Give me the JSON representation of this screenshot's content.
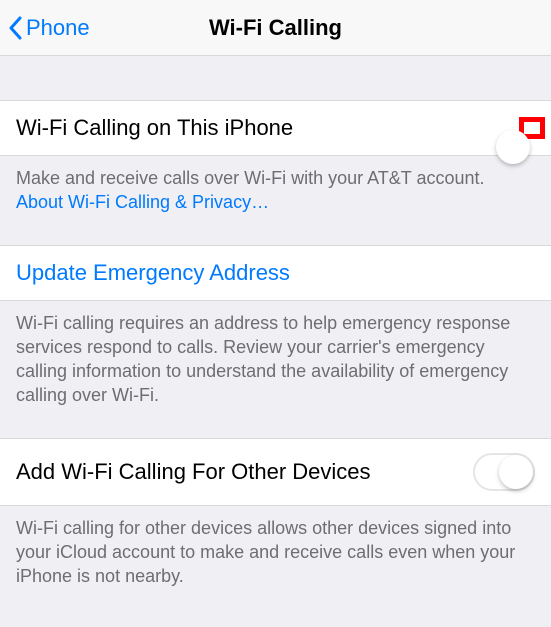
{
  "nav": {
    "back_label": "Phone",
    "title": "Wi-Fi Calling"
  },
  "sections": {
    "wifi_calling": {
      "label": "Wi-Fi Calling on This iPhone",
      "toggle_on": true,
      "footer": "Make and receive calls over Wi-Fi with your AT&T account.",
      "footer_link": "About Wi-Fi Calling & Privacy…"
    },
    "emergency": {
      "link_label": "Update Emergency Address",
      "footer": "Wi-Fi calling requires an address to help emergency response services respond to calls. Review your carrier's emergency calling information to understand the availability of emergency calling over Wi-Fi."
    },
    "other_devices": {
      "label": "Add Wi-Fi Calling For Other Devices",
      "toggle_on": false,
      "footer": "Wi-Fi calling for other devices allows other devices signed into your iCloud account to make and receive calls even when your iPhone is not nearby."
    }
  }
}
